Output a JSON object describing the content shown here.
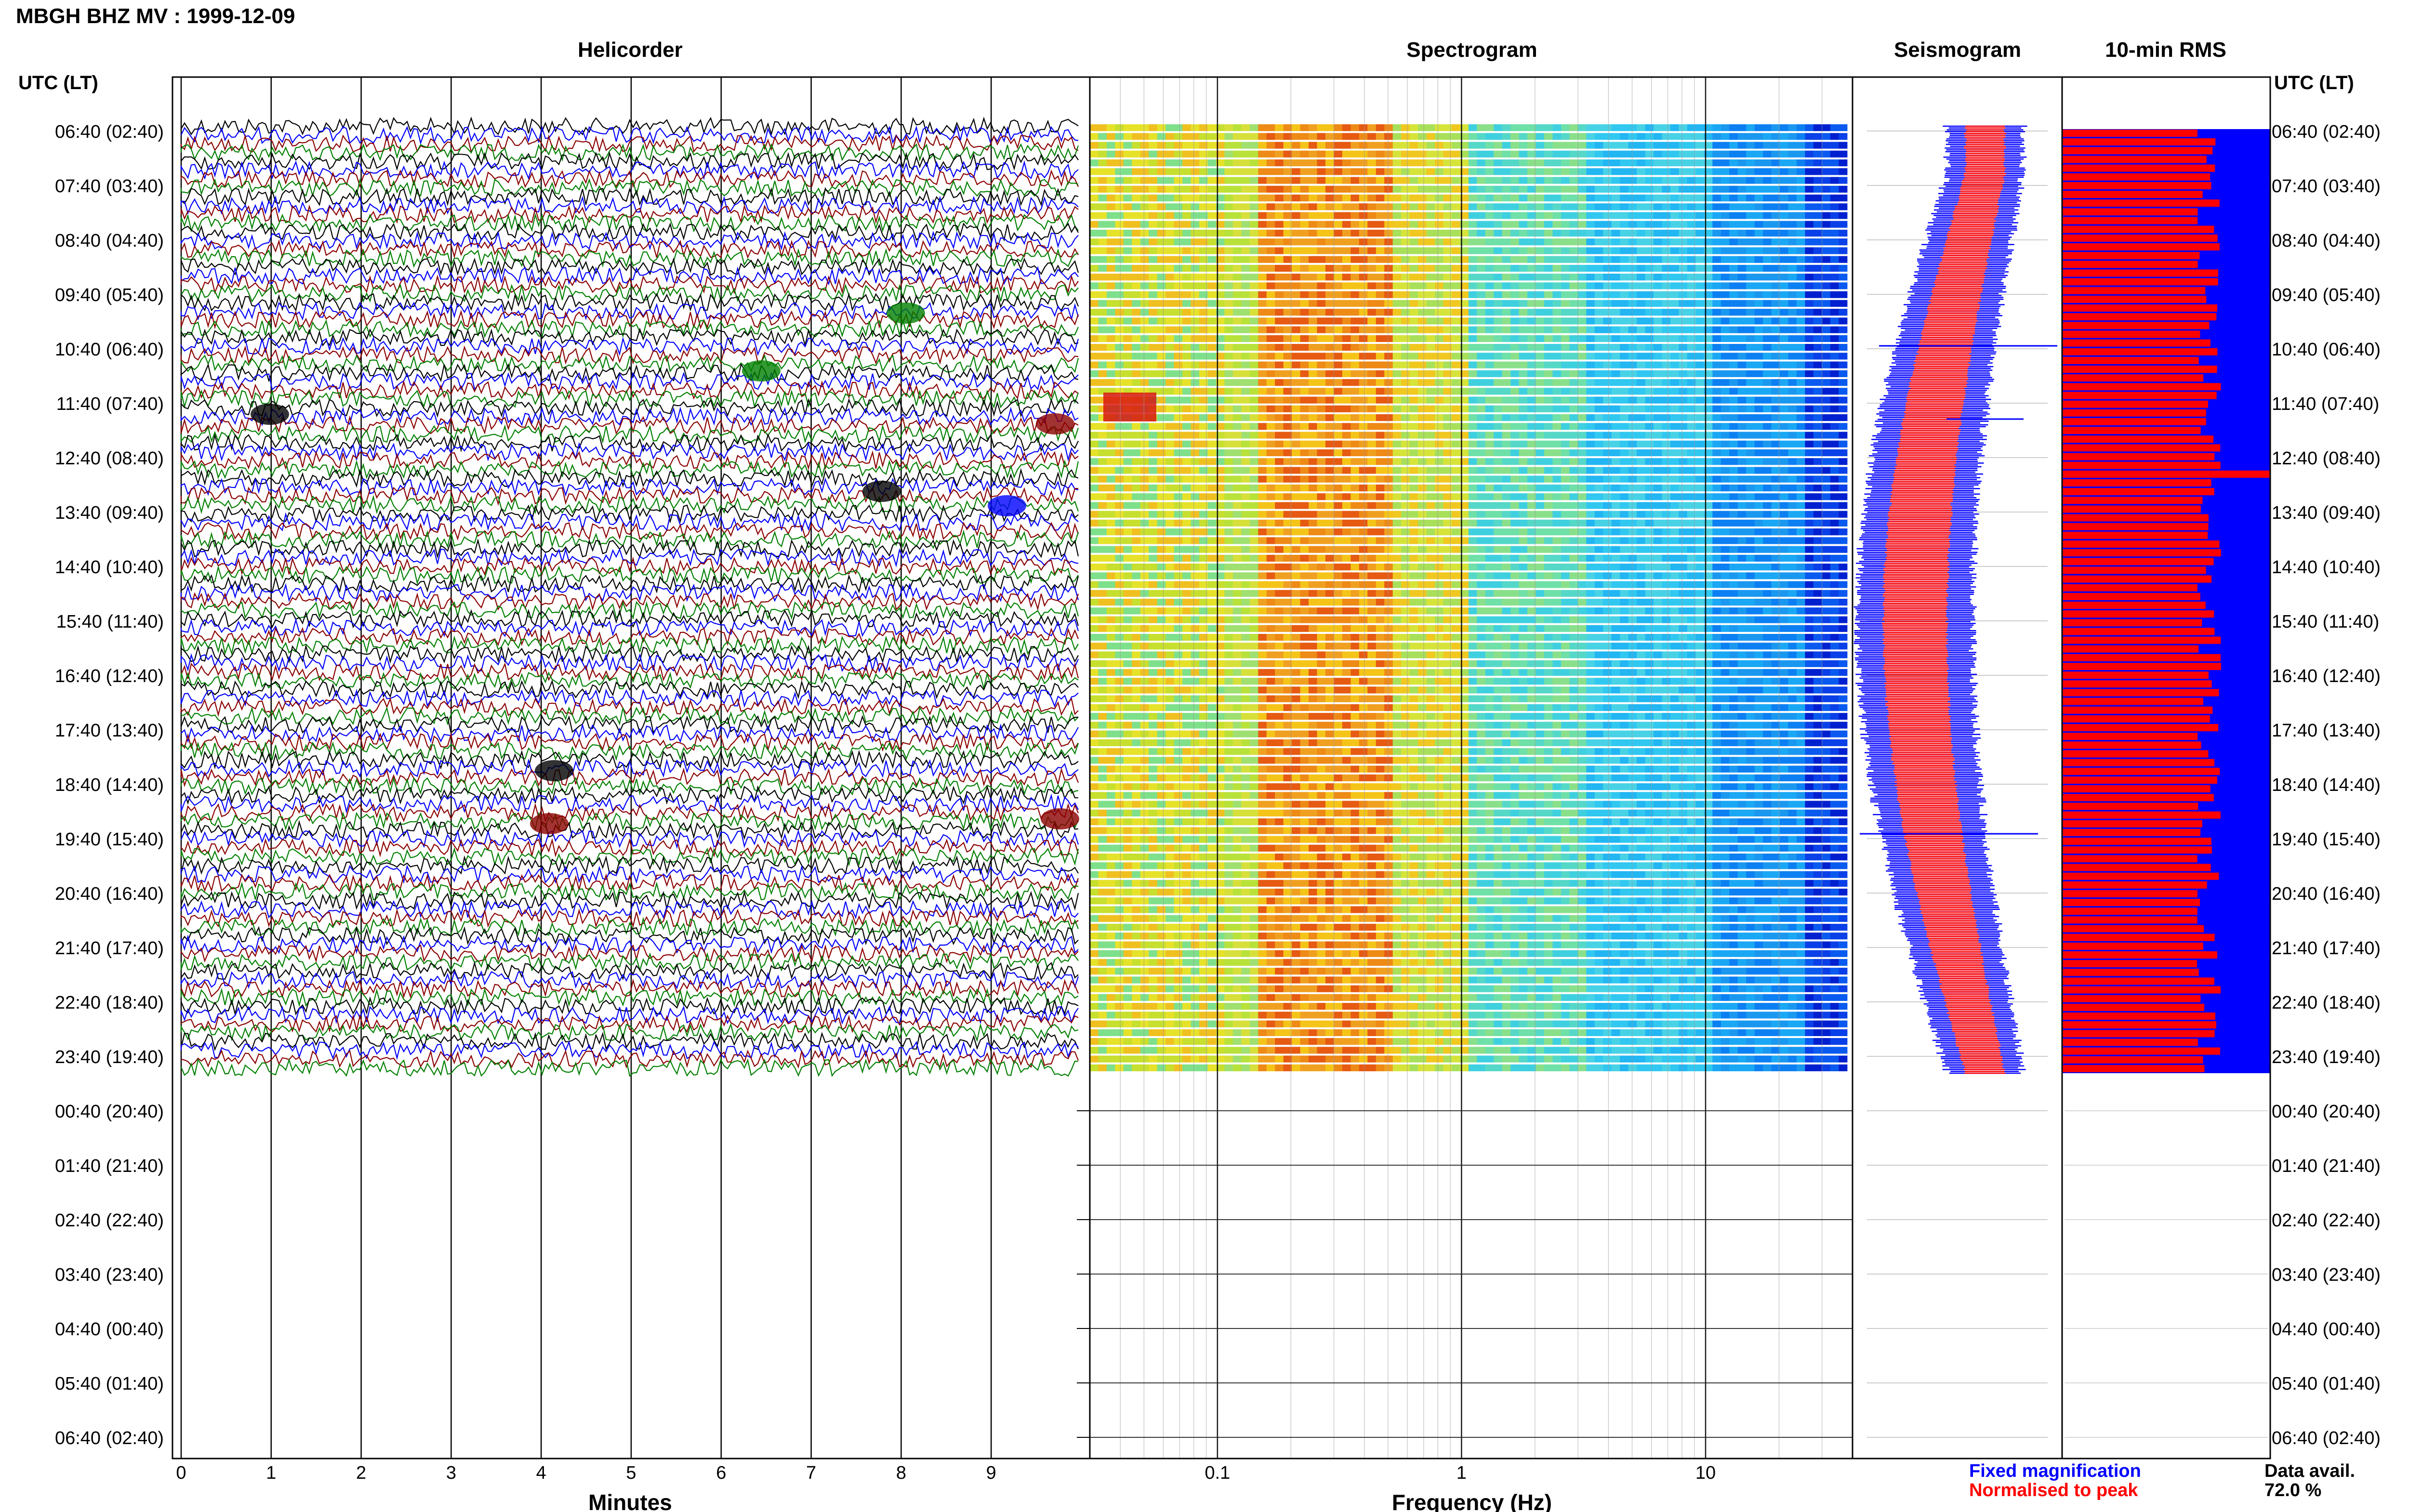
{
  "header": {
    "title": "MBGH BHZ MV : 1999-12-09"
  },
  "panels": {
    "helicorder_title": "Helicorder",
    "spectrogram_title": "Spectrogram",
    "seismogram_title": "Seismogram",
    "rms_title": "10-min RMS"
  },
  "axes": {
    "time_label_left": "UTC (LT)",
    "time_label_right": "UTC (LT)",
    "minutes_label": "Minutes",
    "frequency_label": "Frequency (Hz)"
  },
  "legend": {
    "fixed": "Fixed magnification",
    "normalised": "Normalised to peak",
    "fixed_color": "#0000ff",
    "normalised_color": "#ff0000"
  },
  "data_avail": {
    "label": "Data avail.",
    "value": "72.0 %"
  },
  "chart_data": [
    {
      "type": "line",
      "panel": "helicorder",
      "xlabel": "Minutes",
      "xlim": [
        0,
        10
      ],
      "x_ticks": [
        0,
        1,
        2,
        3,
        4,
        5,
        6,
        7,
        8,
        9
      ],
      "trace_colors": [
        "#000000",
        "#0000ff",
        "#8b0000",
        "#008000"
      ],
      "data_rows": 18
    },
    {
      "type": "heatmap",
      "panel": "spectrogram",
      "xlabel": "Frequency (Hz)",
      "x_scale": "log",
      "xlim": [
        0.03,
        40
      ],
      "x_ticks": [
        "0.1",
        "1",
        "10"
      ],
      "data_rows": 18
    },
    {
      "type": "area",
      "panel": "seismogram",
      "series": [
        {
          "name": "Fixed magnification",
          "color": "#0000ff"
        },
        {
          "name": "Normalised to peak",
          "color": "#ff0000"
        }
      ],
      "data_rows": 18
    },
    {
      "type": "bar",
      "panel": "rms",
      "title": "10-min RMS",
      "series": [
        {
          "name": "Fixed magnification",
          "color": "#0000ff"
        },
        {
          "name": "Normalised to peak",
          "color": "#ff0000"
        }
      ],
      "data_rows": 18
    }
  ],
  "time_rows": [
    "06:40 (02:40)",
    "07:40 (03:40)",
    "08:40 (04:40)",
    "09:40 (05:40)",
    "10:40 (06:40)",
    "11:40 (07:40)",
    "12:40 (08:40)",
    "13:40 (09:40)",
    "14:40 (10:40)",
    "15:40 (11:40)",
    "16:40 (12:40)",
    "17:40 (13:40)",
    "18:40 (14:40)",
    "19:40 (15:40)",
    "20:40 (16:40)",
    "21:40 (17:40)",
    "22:40 (18:40)",
    "23:40 (19:40)",
    "00:40 (20:40)",
    "01:40 (21:40)",
    "02:40 (22:40)",
    "03:40 (23:40)",
    "04:40 (00:40)",
    "05:40 (01:40)",
    "06:40 (02:40)"
  ]
}
